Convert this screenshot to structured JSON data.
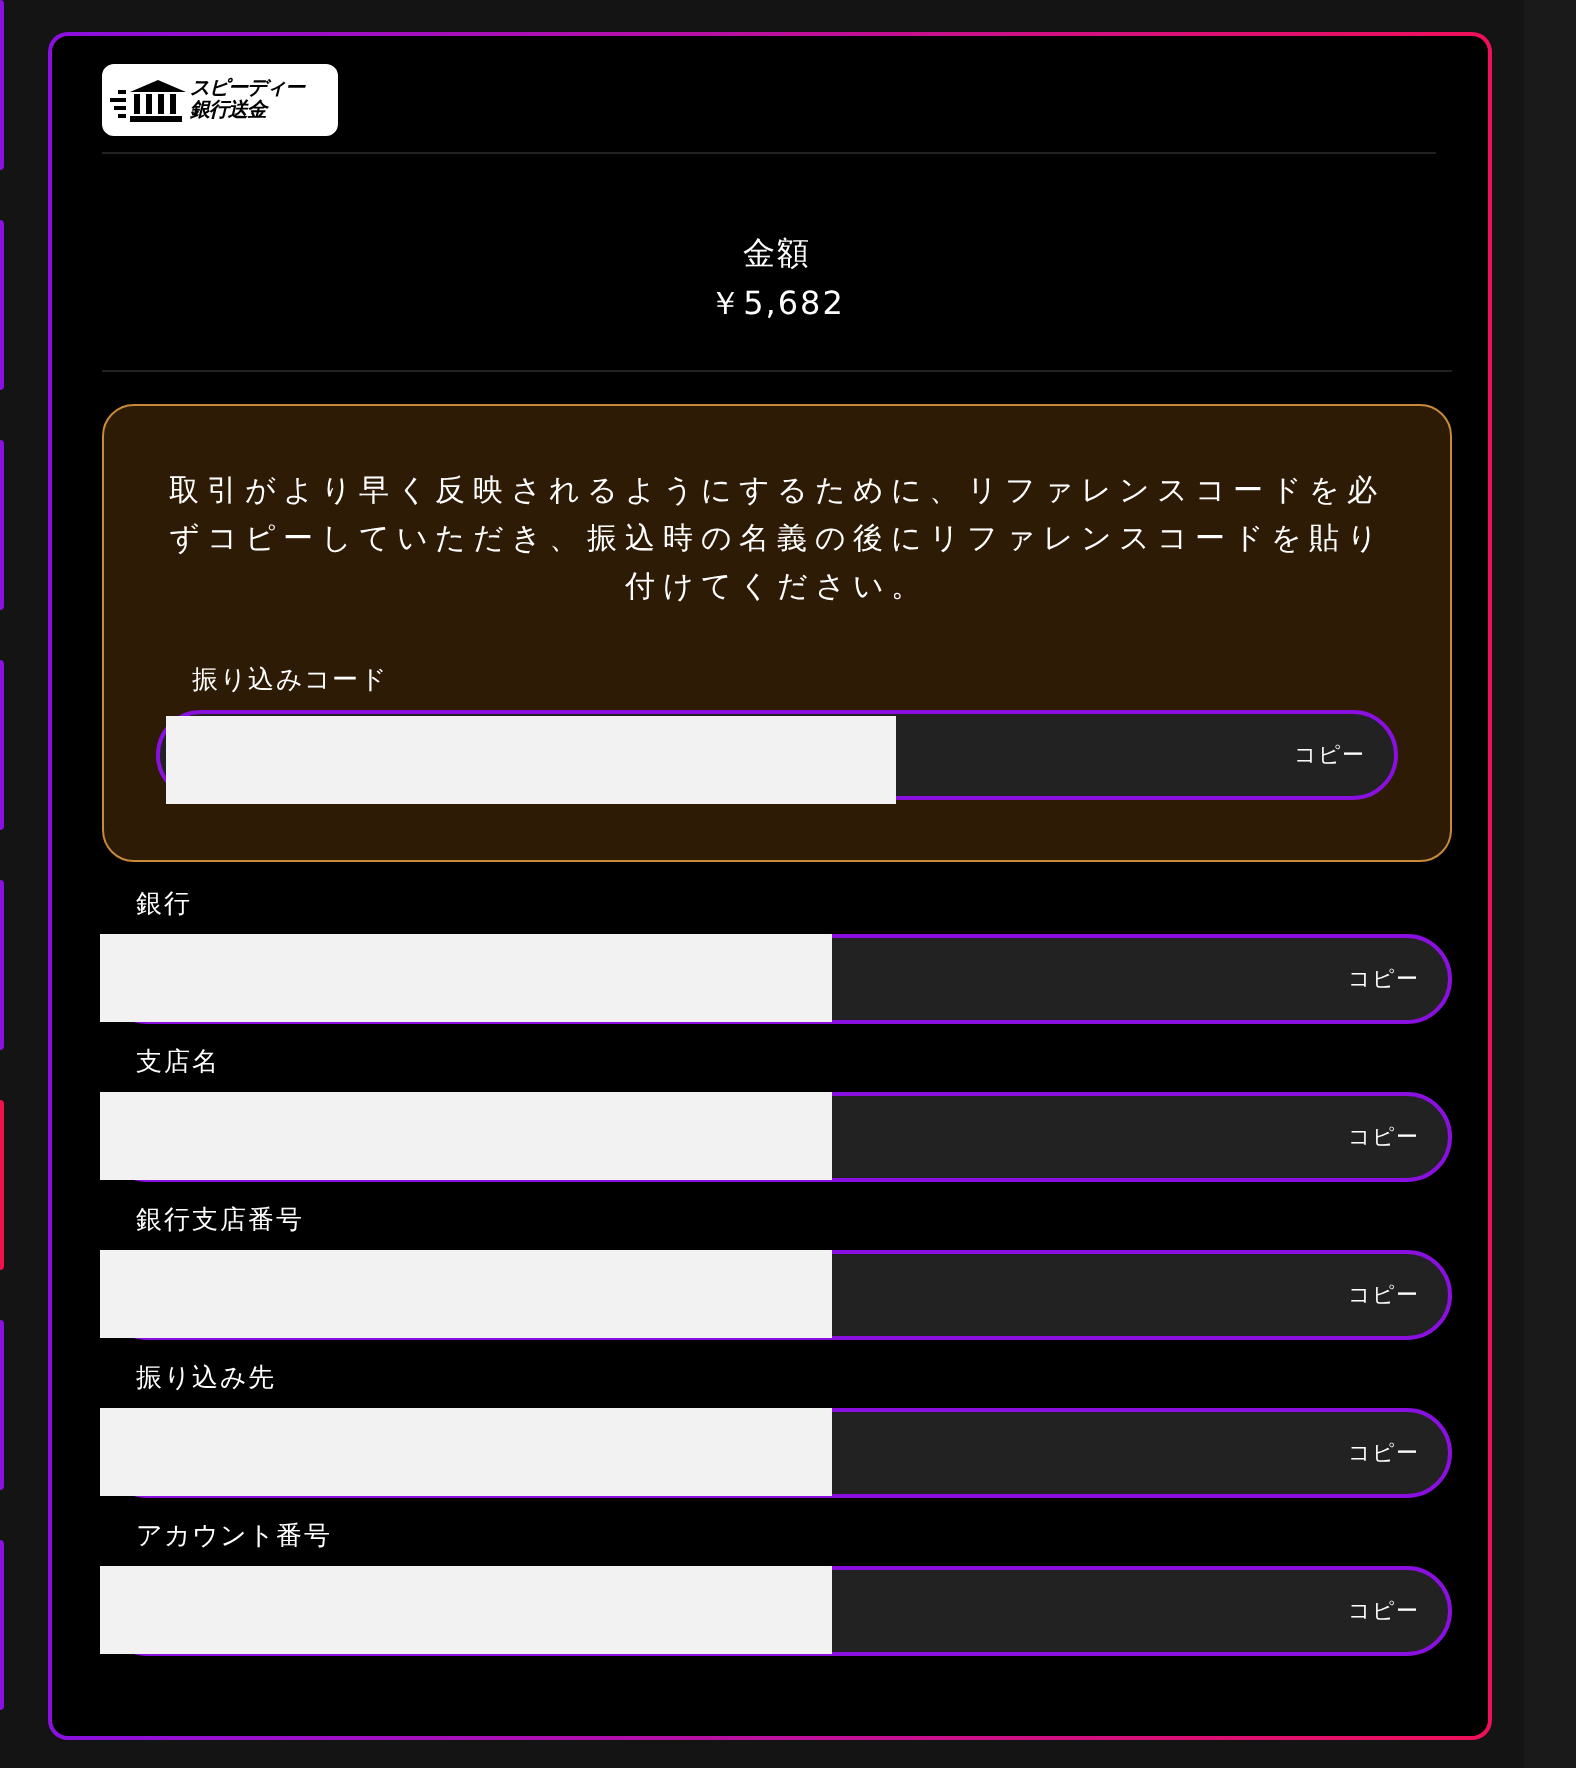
{
  "side_cards": [
    {
      "selected": false
    },
    {
      "selected": false
    },
    {
      "selected": false
    },
    {
      "selected": false
    },
    {
      "selected": false
    },
    {
      "selected": true
    },
    {
      "selected": false
    },
    {
      "selected": false
    }
  ],
  "logo": {
    "line_1": "スピーディー",
    "line_2": "銀行送金"
  },
  "amount": {
    "label": "金額",
    "value": "￥5,682"
  },
  "notice": {
    "text": "取引がより早く反映されるようにするために、リファレンスコードを必ずコピーしていただき、振込時の名義の後にリファレンスコードを貼り付けてください。",
    "field": {
      "label": "振り込みコード",
      "button": "コピー"
    }
  },
  "fields": [
    {
      "label": "銀行",
      "button": "コピー"
    },
    {
      "label": "支店名",
      "button": "コピー"
    },
    {
      "label": "銀行支店番号",
      "button": "コピー"
    },
    {
      "label": "振り込み先",
      "button": "コピー"
    },
    {
      "label": "アカウント番号",
      "button": "コピー"
    }
  ]
}
